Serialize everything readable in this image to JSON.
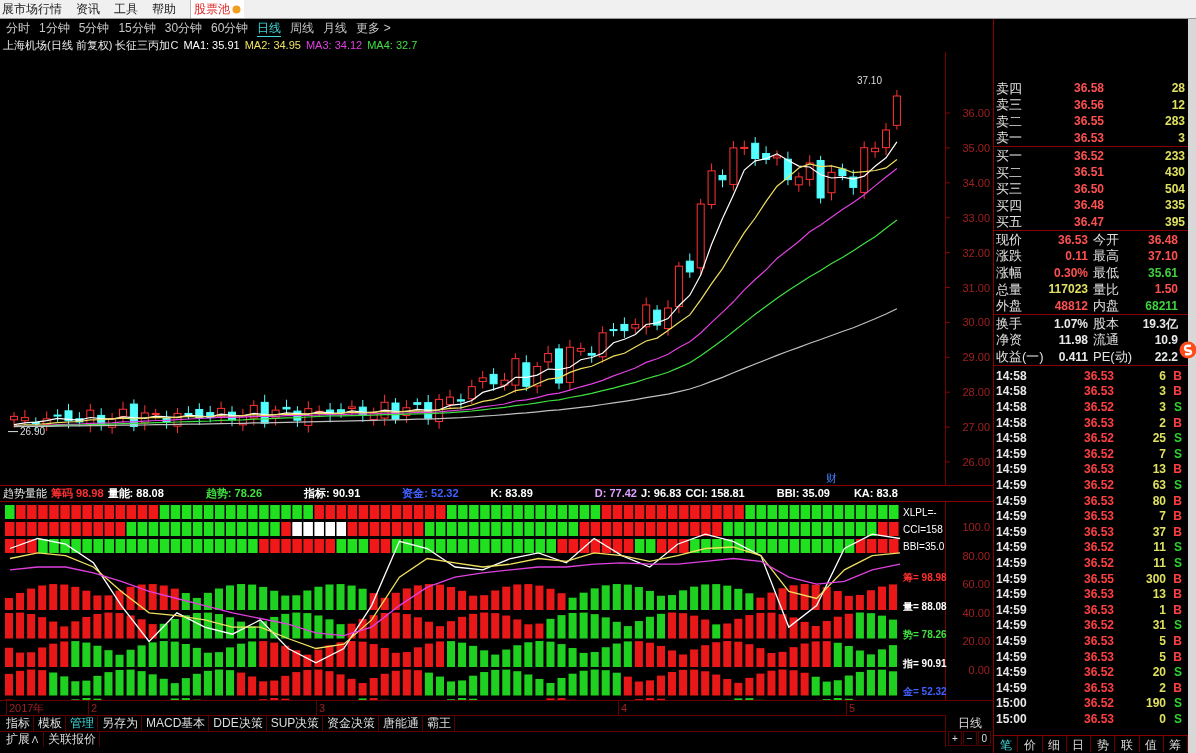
{
  "menu": [
    {
      "label": "展市场行情",
      "kind": "normal"
    },
    {
      "label": "资讯",
      "kind": "normal"
    },
    {
      "label": "工具",
      "kind": "normal"
    },
    {
      "label": "帮助",
      "kind": "normal"
    },
    {
      "label": "股票池",
      "kind": "highlight"
    }
  ],
  "periods": [
    {
      "label": "分时",
      "selected": false
    },
    {
      "label": "1分钟",
      "selected": false
    },
    {
      "label": "5分钟",
      "selected": false
    },
    {
      "label": "15分钟",
      "selected": false
    },
    {
      "label": "30分钟",
      "selected": false
    },
    {
      "label": "60分钟",
      "selected": false
    },
    {
      "label": "日线",
      "selected": true
    },
    {
      "label": "周线",
      "selected": false
    },
    {
      "label": "月线",
      "selected": false
    },
    {
      "label": "更多 >",
      "selected": false
    }
  ],
  "chart_title": {
    "name": "上海机场(日线 前复权) 长征三丙加C",
    "ma": [
      {
        "label": "MA1: 35.91",
        "color": "#ffffff"
      },
      {
        "label": "MA2: 34.95",
        "color": "#f0e060"
      },
      {
        "label": "MA3: 34.12",
        "color": "#e040e0"
      },
      {
        "label": "MA4: 32.7",
        "color": "#40e040"
      }
    ]
  },
  "price_axis": [
    "36.00",
    "35.00",
    "34.00",
    "33.00",
    "32.00",
    "31.00",
    "30.00",
    "29.00",
    "28.00",
    "27.00",
    "26.00"
  ],
  "high_label": "37.10",
  "low_label": "26.90",
  "event_marker": "财",
  "indicator": {
    "title": "趋势量能",
    "values": [
      {
        "label": "筹码 98.98",
        "color": "#ff3030"
      },
      {
        "label": "量能: 88.08",
        "color": "#ffffff"
      },
      {
        "label": "趋势: 78.26",
        "color": "#40e040"
      },
      {
        "label": "指标: 90.91",
        "color": "#ffffff"
      },
      {
        "label": "资金: 52.32",
        "color": "#4060ff"
      },
      {
        "label": "K: 83.89",
        "color": "#ffffff"
      },
      {
        "label": "D: 77.42",
        "color": "#e0a0ff"
      },
      {
        "label": "J: 96.83",
        "color": "#ffffff"
      },
      {
        "label": "CCI: 158.81",
        "color": "#ffffff"
      },
      {
        "label": "BBI: 35.09",
        "color": "#ffffff"
      },
      {
        "label": "KA: 83.8",
        "color": "#ffffff"
      }
    ],
    "signal_labels": [
      "XLPL=-",
      "CCI=158",
      "BBI=35.0"
    ],
    "band_labels": [
      {
        "label": "筹= 98.98",
        "color": "#ff3030"
      },
      {
        "label": "量= 88.08",
        "color": "#ffffff"
      },
      {
        "label": "势= 78.26",
        "color": "#40e040"
      },
      {
        "label": "指= 90.91",
        "color": "#ffffff"
      },
      {
        "label": "金= 52.32",
        "color": "#4060ff"
      }
    ],
    "chart_data": {
      "type": "line",
      "ylim": [
        -21,
        117.5
      ],
      "yticks": [
        {
          "value": 100,
          "label": "100.0"
        },
        {
          "value": 80,
          "label": "80.00"
        },
        {
          "value": 60,
          "label": "60.00"
        },
        {
          "value": 40,
          "label": "40.00"
        },
        {
          "value": 20,
          "label": "20.00"
        },
        {
          "value": 0,
          "label": "0.00"
        }
      ],
      "series": [
        {
          "color": "#ffffff",
          "values": [
            85,
            92,
            88,
            75,
            45,
            20,
            40,
            30,
            25,
            35,
            15,
            5,
            15,
            45,
            90,
            85,
            72,
            70,
            78,
            82,
            75,
            92,
            80,
            72,
            88,
            95,
            90,
            80,
            30,
            45,
            85,
            95,
            92
          ]
        },
        {
          "color": "#f0e060",
          "values": [
            78,
            82,
            80,
            72,
            55,
            40,
            38,
            35,
            30,
            30,
            22,
            15,
            18,
            35,
            65,
            78,
            75,
            72,
            74,
            78,
            76,
            82,
            80,
            76,
            80,
            85,
            86,
            80,
            55,
            50,
            70,
            80,
            82
          ]
        },
        {
          "color": "#e040e0",
          "values": [
            70,
            72,
            72,
            68,
            62,
            55,
            50,
            45,
            40,
            36,
            32,
            26,
            24,
            30,
            45,
            58,
            65,
            68,
            70,
            72,
            72,
            74,
            75,
            74,
            74,
            76,
            78,
            76,
            65,
            60,
            62,
            70,
            74
          ]
        }
      ]
    }
  },
  "dates": [
    "2017年",
    "2",
    "3",
    "4",
    "5"
  ],
  "bottom_tabs": [
    {
      "label": "指标",
      "selected": false
    },
    {
      "label": "模板",
      "selected": false
    },
    {
      "label": "管理",
      "selected": true
    },
    {
      "label": "另存为",
      "selected": false
    },
    {
      "label": "MACD基本",
      "selected": false
    },
    {
      "label": "DDE决策",
      "selected": false
    },
    {
      "label": "SUP决策",
      "selected": false
    },
    {
      "label": "资金决策",
      "selected": false
    },
    {
      "label": "唐能通",
      "selected": false
    },
    {
      "label": "霸王",
      "selected": false
    }
  ],
  "bottom_tabs_2": [
    {
      "label": "扩展∧"
    },
    {
      "label": "关联报价"
    }
  ],
  "period_label": "日线",
  "zoom_buttons": [
    "+",
    "−",
    "0"
  ],
  "order_book": {
    "asks": [
      {
        "label": "卖四",
        "price": "36.58",
        "volume": "28"
      },
      {
        "label": "卖三",
        "price": "36.56",
        "volume": "12"
      },
      {
        "label": "卖二",
        "price": "36.55",
        "volume": "283"
      },
      {
        "label": "卖一",
        "price": "36.53",
        "volume": "3"
      }
    ],
    "bids": [
      {
        "label": "买一",
        "price": "36.52",
        "volume": "233"
      },
      {
        "label": "买二",
        "price": "36.51",
        "volume": "430"
      },
      {
        "label": "买三",
        "price": "36.50",
        "volume": "504"
      },
      {
        "label": "买四",
        "price": "36.48",
        "volume": "335"
      },
      {
        "label": "买五",
        "price": "36.47",
        "volume": "395"
      }
    ]
  },
  "quote_groups": [
    [
      {
        "label": "现价",
        "value": "36.53",
        "color": "#ff5050"
      },
      {
        "label": "今开",
        "value": "36.48",
        "color": "#ff5050"
      },
      {
        "label": "涨跌",
        "value": "0.11",
        "color": "#ff5050"
      },
      {
        "label": "最高",
        "value": "37.10",
        "color": "#ff5050"
      },
      {
        "label": "涨幅",
        "value": "0.30%",
        "color": "#ff5050"
      },
      {
        "label": "最低",
        "value": "35.61",
        "color": "#40d040"
      },
      {
        "label": "总量",
        "value": "117023",
        "color": "#e0e060"
      },
      {
        "label": "量比",
        "value": "1.50",
        "color": "#ff5050"
      },
      {
        "label": "外盘",
        "value": "48812",
        "color": "#ff5050"
      },
      {
        "label": "内盘",
        "value": "68211",
        "color": "#40d040"
      }
    ],
    [
      {
        "label": "换手",
        "value": "1.07%",
        "color": "#e8e8e8"
      },
      {
        "label": "股本",
        "value": "19.3亿",
        "color": "#e8e8e8"
      },
      {
        "label": "净资",
        "value": "11.98",
        "color": "#e8e8e8"
      },
      {
        "label": "流通",
        "value": "10.9",
        "color": "#e8e8e8"
      },
      {
        "label": "收益(一)",
        "value": "0.411",
        "color": "#e8e8e8"
      },
      {
        "label": "PE(动)",
        "value": "22.2",
        "color": "#e8e8e8"
      }
    ]
  ],
  "trades": [
    {
      "time": "14:58",
      "price": "36.53",
      "volume": "6",
      "side": "B",
      "kind": "buy"
    },
    {
      "time": "14:58",
      "price": "36.53",
      "volume": "3",
      "side": "B",
      "kind": "buy"
    },
    {
      "time": "14:58",
      "price": "36.52",
      "volume": "3",
      "side": "S",
      "kind": "sell"
    },
    {
      "time": "14:58",
      "price": "36.53",
      "volume": "2",
      "side": "B",
      "kind": "buy"
    },
    {
      "time": "14:58",
      "price": "36.52",
      "volume": "25",
      "side": "S",
      "kind": "sell"
    },
    {
      "time": "14:59",
      "price": "36.52",
      "volume": "7",
      "side": "S",
      "kind": "sell"
    },
    {
      "time": "14:59",
      "price": "36.53",
      "volume": "13",
      "side": "B",
      "kind": "buy"
    },
    {
      "time": "14:59",
      "price": "36.52",
      "volume": "63",
      "side": "S",
      "kind": "sell"
    },
    {
      "time": "14:59",
      "price": "36.53",
      "volume": "80",
      "side": "B",
      "kind": "buy"
    },
    {
      "time": "14:59",
      "price": "36.53",
      "volume": "7",
      "side": "B",
      "kind": "buy"
    },
    {
      "time": "14:59",
      "price": "36.53",
      "volume": "37",
      "side": "B",
      "kind": "buy"
    },
    {
      "time": "14:59",
      "price": "36.52",
      "volume": "11",
      "side": "S",
      "kind": "sell"
    },
    {
      "time": "14:59",
      "price": "36.52",
      "volume": "11",
      "side": "S",
      "kind": "sell"
    },
    {
      "time": "14:59",
      "price": "36.55",
      "volume": "300",
      "side": "B",
      "kind": "buy"
    },
    {
      "time": "14:59",
      "price": "36.53",
      "volume": "13",
      "side": "B",
      "kind": "buy"
    },
    {
      "time": "14:59",
      "price": "36.53",
      "volume": "1",
      "side": "B",
      "kind": "buy"
    },
    {
      "time": "14:59",
      "price": "36.52",
      "volume": "31",
      "side": "S",
      "kind": "sell"
    },
    {
      "time": "14:59",
      "price": "36.53",
      "volume": "5",
      "side": "B",
      "kind": "buy"
    },
    {
      "time": "14:59",
      "price": "36.53",
      "volume": "5",
      "side": "B",
      "kind": "buy"
    },
    {
      "time": "14:59",
      "price": "36.52",
      "volume": "20",
      "side": "S",
      "kind": "sell"
    },
    {
      "time": "14:59",
      "price": "36.53",
      "volume": "2",
      "side": "B",
      "kind": "buy"
    },
    {
      "time": "15:00",
      "price": "36.52",
      "volume": "190",
      "side": "S",
      "kind": "sell"
    },
    {
      "time": "15:00",
      "price": "36.53",
      "volume": "0",
      "side": "S",
      "kind": "sell"
    }
  ],
  "detail_tabs": [
    {
      "label": "笔",
      "selected": true
    },
    {
      "label": "价",
      "selected": false
    },
    {
      "label": "细",
      "selected": false
    },
    {
      "label": "日",
      "selected": false
    },
    {
      "label": "势",
      "selected": false
    },
    {
      "label": "联",
      "selected": false
    },
    {
      "label": "值",
      "selected": false
    },
    {
      "label": "筹",
      "selected": false
    }
  ]
}
